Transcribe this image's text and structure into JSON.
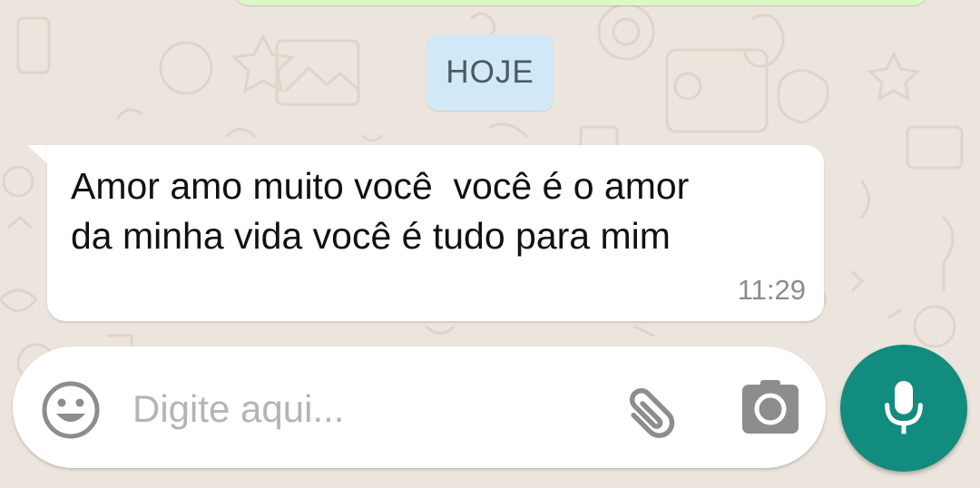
{
  "conversation": {
    "date_divider": "HOJE",
    "messages": [
      {
        "direction": "incoming",
        "text": "Amor amo muito você  você é o amor\nda minha vida você é tudo para mim",
        "time": "11:29"
      }
    ]
  },
  "composer": {
    "placeholder": "Digite aqui...",
    "value": "",
    "emoji_icon": "emoji-icon",
    "attach_icon": "paperclip-icon",
    "camera_icon": "camera-icon",
    "send_icon": "microphone-icon"
  },
  "colors": {
    "wallpaper": "#ECE5DD",
    "incoming_bubble": "#FFFFFF",
    "outgoing_bubble": "#DCF8C6",
    "date_chip": "#D1E9F6",
    "accent": "#128C7E"
  }
}
